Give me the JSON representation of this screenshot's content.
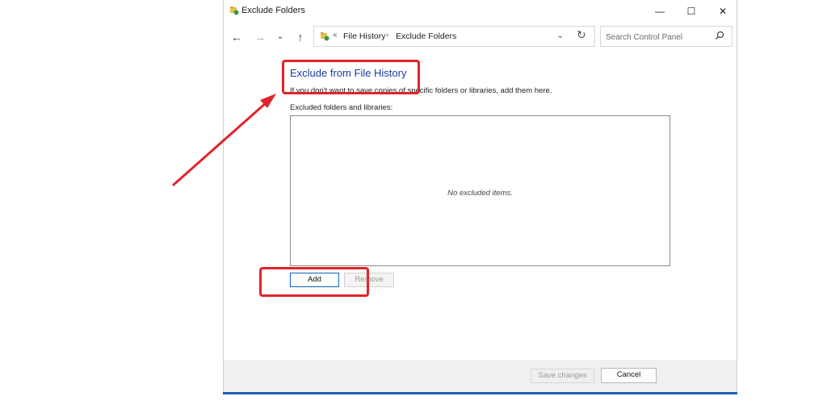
{
  "window": {
    "title": "Exclude Folders",
    "controls": {
      "minimize": "—",
      "maximize": "☐",
      "close": "✕"
    }
  },
  "navbar": {
    "back": "←",
    "forward": "→",
    "recent": "⌄",
    "up": "↑",
    "address": {
      "separator": "«",
      "crumbs": [
        "File History",
        "Exclude Folders"
      ],
      "crumb_separator": "›",
      "dropdown": "⌄",
      "refresh": "↻"
    },
    "search": {
      "placeholder": "Search Control Panel"
    }
  },
  "content": {
    "heading": "Exclude from File History",
    "description": "If you don't want to save copies of specific folders or libraries, add them here.",
    "list_label": "Excluded folders and libraries:",
    "empty_text": "No excluded items.",
    "add_label": "Add",
    "remove_label": "Remove"
  },
  "footer": {
    "save_label": "Save changes",
    "cancel_label": "Cancel"
  },
  "colors": {
    "heading": "#1c3c9c",
    "annotation": "#e0242a",
    "accent_border": "#0a64c8"
  }
}
